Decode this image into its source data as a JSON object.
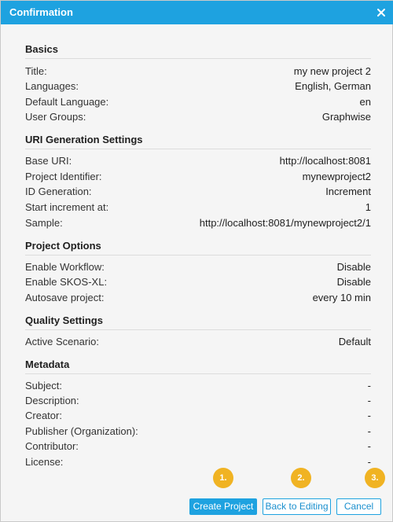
{
  "dialog": {
    "title": "Confirmation"
  },
  "sections": {
    "basics": {
      "title": "Basics",
      "rows": [
        {
          "label": "Title:",
          "value": "my new project 2"
        },
        {
          "label": "Languages:",
          "value": "English, German"
        },
        {
          "label": "Default Language:",
          "value": "en"
        },
        {
          "label": "User Groups:",
          "value": "Graphwise"
        }
      ]
    },
    "uri": {
      "title": "URI Generation Settings",
      "rows": [
        {
          "label": "Base URI:",
          "value": "http://localhost:8081"
        },
        {
          "label": "Project Identifier:",
          "value": "mynewproject2"
        },
        {
          "label": "ID Generation:",
          "value": "Increment"
        },
        {
          "label": "Start increment at:",
          "value": "1"
        },
        {
          "label": "Sample:",
          "value": "http://localhost:8081/mynewproject2/1"
        }
      ]
    },
    "options": {
      "title": "Project Options",
      "rows": [
        {
          "label": "Enable Workflow:",
          "value": "Disable"
        },
        {
          "label": "Enable SKOS-XL:",
          "value": "Disable"
        },
        {
          "label": "Autosave project:",
          "value": "every 10 min"
        }
      ]
    },
    "quality": {
      "title": "Quality Settings",
      "rows": [
        {
          "label": "Active Scenario:",
          "value": "Default"
        }
      ]
    },
    "metadata": {
      "title": "Metadata",
      "rows": [
        {
          "label": "Subject:",
          "value": "-"
        },
        {
          "label": "Description:",
          "value": "-"
        },
        {
          "label": "Creator:",
          "value": "-"
        },
        {
          "label": "Publisher (Organization):",
          "value": "-"
        },
        {
          "label": "Contributor:",
          "value": "-"
        },
        {
          "label": "License:",
          "value": "-"
        }
      ]
    }
  },
  "badges": [
    "1.",
    "2.",
    "3."
  ],
  "buttons": {
    "create": "Create Project",
    "back": "Back to Editing",
    "cancel": "Cancel"
  },
  "colors": {
    "accent": "#1ea2e0",
    "badge": "#f0b323"
  },
  "icons": {
    "close": "close-icon"
  }
}
